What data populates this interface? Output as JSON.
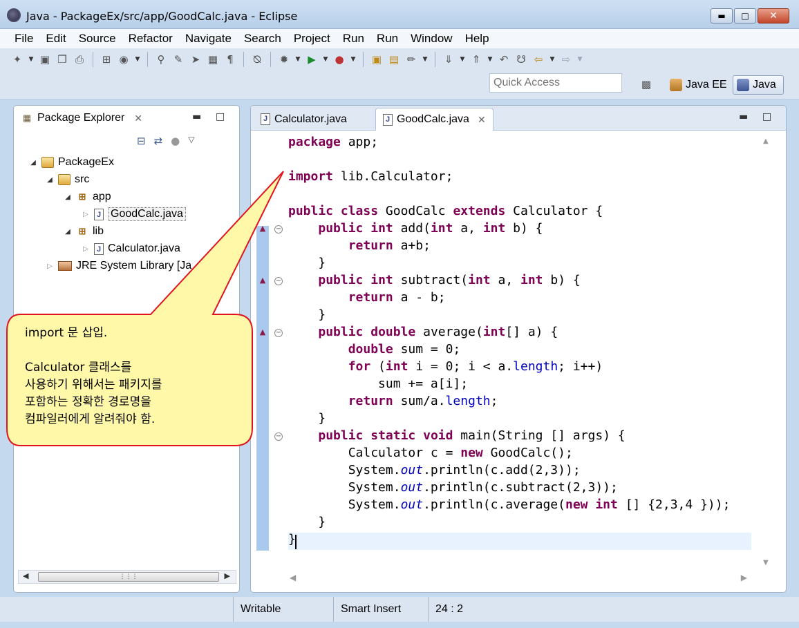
{
  "window": {
    "title": "Java - PackageEx/src/app/GoodCalc.java - Eclipse"
  },
  "menu": [
    "File",
    "Edit",
    "Source",
    "Refactor",
    "Navigate",
    "Search",
    "Project",
    "Run",
    "Run",
    "Window",
    "Help"
  ],
  "toolbar": {
    "quick_access_placeholder": "Quick Access",
    "perspectives": [
      "Java EE",
      "Java"
    ]
  },
  "package_explorer": {
    "title": "Package Explorer",
    "tree": [
      {
        "label": "PackageEx",
        "type": "project",
        "expanded": true
      },
      {
        "label": "src",
        "type": "source-folder",
        "expanded": true
      },
      {
        "label": "app",
        "type": "package",
        "expanded": true
      },
      {
        "label": "GoodCalc.java",
        "type": "java-file",
        "selected": true
      },
      {
        "label": "lib",
        "type": "package",
        "expanded": true
      },
      {
        "label": "Calculator.java",
        "type": "java-file"
      },
      {
        "label": "JRE System Library [Ja",
        "type": "library"
      }
    ]
  },
  "editor": {
    "tabs": [
      {
        "label": "Calculator.java",
        "active": false
      },
      {
        "label": "GoodCalc.java",
        "active": true
      }
    ],
    "code": [
      [
        {
          "k": "kw",
          "t": "package"
        },
        {
          "t": " app;"
        }
      ],
      [],
      [
        {
          "k": "kw",
          "t": "import"
        },
        {
          "t": " lib.Calculator;"
        }
      ],
      [],
      [
        {
          "k": "kw",
          "t": "public"
        },
        {
          "t": " "
        },
        {
          "k": "kw",
          "t": "class"
        },
        {
          "t": " GoodCalc "
        },
        {
          "k": "kw",
          "t": "extends"
        },
        {
          "t": " Calculator {"
        }
      ],
      [
        {
          "t": "    "
        },
        {
          "k": "kw",
          "t": "public"
        },
        {
          "t": " "
        },
        {
          "k": "kw",
          "t": "int"
        },
        {
          "t": " add("
        },
        {
          "k": "kw",
          "t": "int"
        },
        {
          "t": " a, "
        },
        {
          "k": "kw",
          "t": "int"
        },
        {
          "t": " b) {"
        }
      ],
      [
        {
          "t": "        "
        },
        {
          "k": "kw",
          "t": "return"
        },
        {
          "t": " a+b;"
        }
      ],
      [
        {
          "t": "    }"
        }
      ],
      [
        {
          "t": "    "
        },
        {
          "k": "kw",
          "t": "public"
        },
        {
          "t": " "
        },
        {
          "k": "kw",
          "t": "int"
        },
        {
          "t": " subtract("
        },
        {
          "k": "kw",
          "t": "int"
        },
        {
          "t": " a, "
        },
        {
          "k": "kw",
          "t": "int"
        },
        {
          "t": " b) {"
        }
      ],
      [
        {
          "t": "        "
        },
        {
          "k": "kw",
          "t": "return"
        },
        {
          "t": " a - b;"
        }
      ],
      [
        {
          "t": "    }"
        }
      ],
      [
        {
          "t": "    "
        },
        {
          "k": "kw",
          "t": "public"
        },
        {
          "t": " "
        },
        {
          "k": "kw",
          "t": "double"
        },
        {
          "t": " average("
        },
        {
          "k": "kw",
          "t": "int"
        },
        {
          "t": "[] a) {"
        }
      ],
      [
        {
          "t": "        "
        },
        {
          "k": "kw",
          "t": "double"
        },
        {
          "t": " sum = 0;"
        }
      ],
      [
        {
          "t": "        "
        },
        {
          "k": "kw",
          "t": "for"
        },
        {
          "t": " ("
        },
        {
          "k": "kw",
          "t": "int"
        },
        {
          "t": " i = 0; i < a."
        },
        {
          "k": "fld",
          "t": "length"
        },
        {
          "t": "; i++)"
        }
      ],
      [
        {
          "t": "            sum += a[i];"
        }
      ],
      [
        {
          "t": "        "
        },
        {
          "k": "kw",
          "t": "return"
        },
        {
          "t": " sum/a."
        },
        {
          "k": "fld",
          "t": "length"
        },
        {
          "t": ";"
        }
      ],
      [
        {
          "t": "    }"
        }
      ],
      [
        {
          "t": "    "
        },
        {
          "k": "kw",
          "t": "public"
        },
        {
          "t": " "
        },
        {
          "k": "kw",
          "t": "static"
        },
        {
          "t": " "
        },
        {
          "k": "kw",
          "t": "void"
        },
        {
          "t": " main(String [] args) {"
        }
      ],
      [
        {
          "t": "        Calculator c = "
        },
        {
          "k": "kw",
          "t": "new"
        },
        {
          "t": " GoodCalc();"
        }
      ],
      [
        {
          "t": "        System."
        },
        {
          "k": "sfld",
          "t": "out"
        },
        {
          "t": ".println(c.add(2,3));"
        }
      ],
      [
        {
          "t": "        System."
        },
        {
          "k": "sfld",
          "t": "out"
        },
        {
          "t": ".println(c.subtract(2,3));"
        }
      ],
      [
        {
          "t": "        System."
        },
        {
          "k": "sfld",
          "t": "out"
        },
        {
          "t": ".println(c.average("
        },
        {
          "k": "kw",
          "t": "new"
        },
        {
          "t": " "
        },
        {
          "k": "kw",
          "t": "int"
        },
        {
          "t": " [] {2,3,4 }));"
        }
      ],
      [
        {
          "t": "    }"
        }
      ],
      [
        {
          "t": "}"
        }
      ]
    ]
  },
  "callout": {
    "line1": "import 문 삽입.",
    "line2": "Calculator 클래스를",
    "line3": "사용하기 위해서는 패키지를",
    "line4": "포함하는 정확한 경로명을",
    "line5": "컴파일러에게 알려줘야 함."
  },
  "status": {
    "writable": "Writable",
    "insert_mode": "Smart Insert",
    "cursor_position": "24 : 2"
  },
  "colors": {
    "keyword": "#7f0055",
    "field": "#0000c0",
    "callout_fill": "#fff8a8",
    "callout_border": "#e0141e",
    "window_frame": "#c5d9ee"
  }
}
